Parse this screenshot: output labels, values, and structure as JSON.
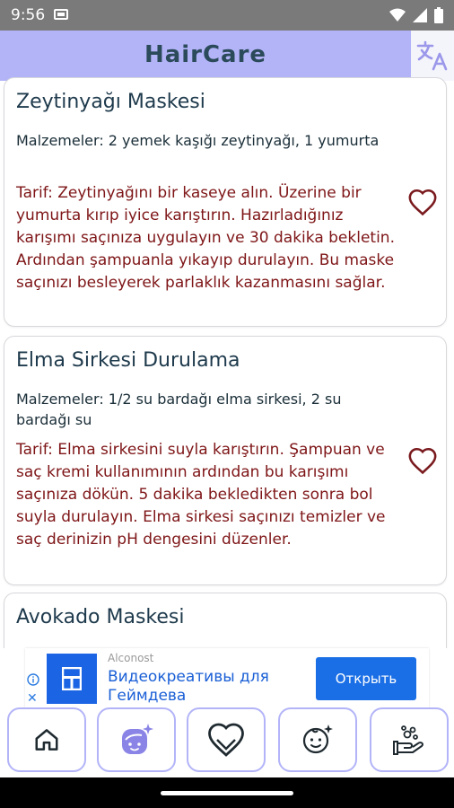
{
  "status_bar": {
    "time": "9:56"
  },
  "app": {
    "title": "HairCare"
  },
  "recipes": [
    {
      "title": "Zeytinyağı Maskesi",
      "ingredients": "Malzemeler: 2 yemek kaşığı zeytinyağı, 1 yumurta",
      "recipe": "Tarif: Zeytinyağını bir kaseye alın. Üzerine bir yumurta kırıp iyice karıştırın. Hazırladığınız karışımı saçınıza uygulayın ve 30 dakika bekletin. Ardından şampuanla yıkayıp durulayın. Bu maske saçınızı besleyerek parlaklık kazanmasını sağlar."
    },
    {
      "title": "Elma Sirkesi Durulama",
      "ingredients": "Malzemeler: 1/2 su bardağı elma sirkesi, 2 su bardağı su",
      "recipe": "Tarif: Elma sirkesini suyla karıştırın. Şampuan ve saç kremi kullanımının ardından bu karışımı saçınıza dökün. 5 dakika bekledikten sonra bol suyla durulayın. Elma sirkesi saçınızı temizler ve saç derinizin pH dengesini düzenler."
    },
    {
      "title": "Avokado Maskesi"
    }
  ],
  "ad": {
    "brand": "Alconost",
    "text": "Видеокреативы для Геймдева",
    "cta": "Открыть"
  },
  "colors": {
    "app_bar": "#b3b4f8",
    "title_text": "#2b4a5a",
    "recipe_text": "#7e1517",
    "heart": "#7a1a1e",
    "nav_border": "#b3b4f8",
    "nav_icon": "#8a84e6"
  },
  "icons": {
    "translate": "translate-icon",
    "favorite": "heart-outline-icon",
    "nav": [
      "home-icon",
      "face-sparkle-icon",
      "heart-icon",
      "baby-face-icon",
      "hand-wash-icon"
    ]
  }
}
